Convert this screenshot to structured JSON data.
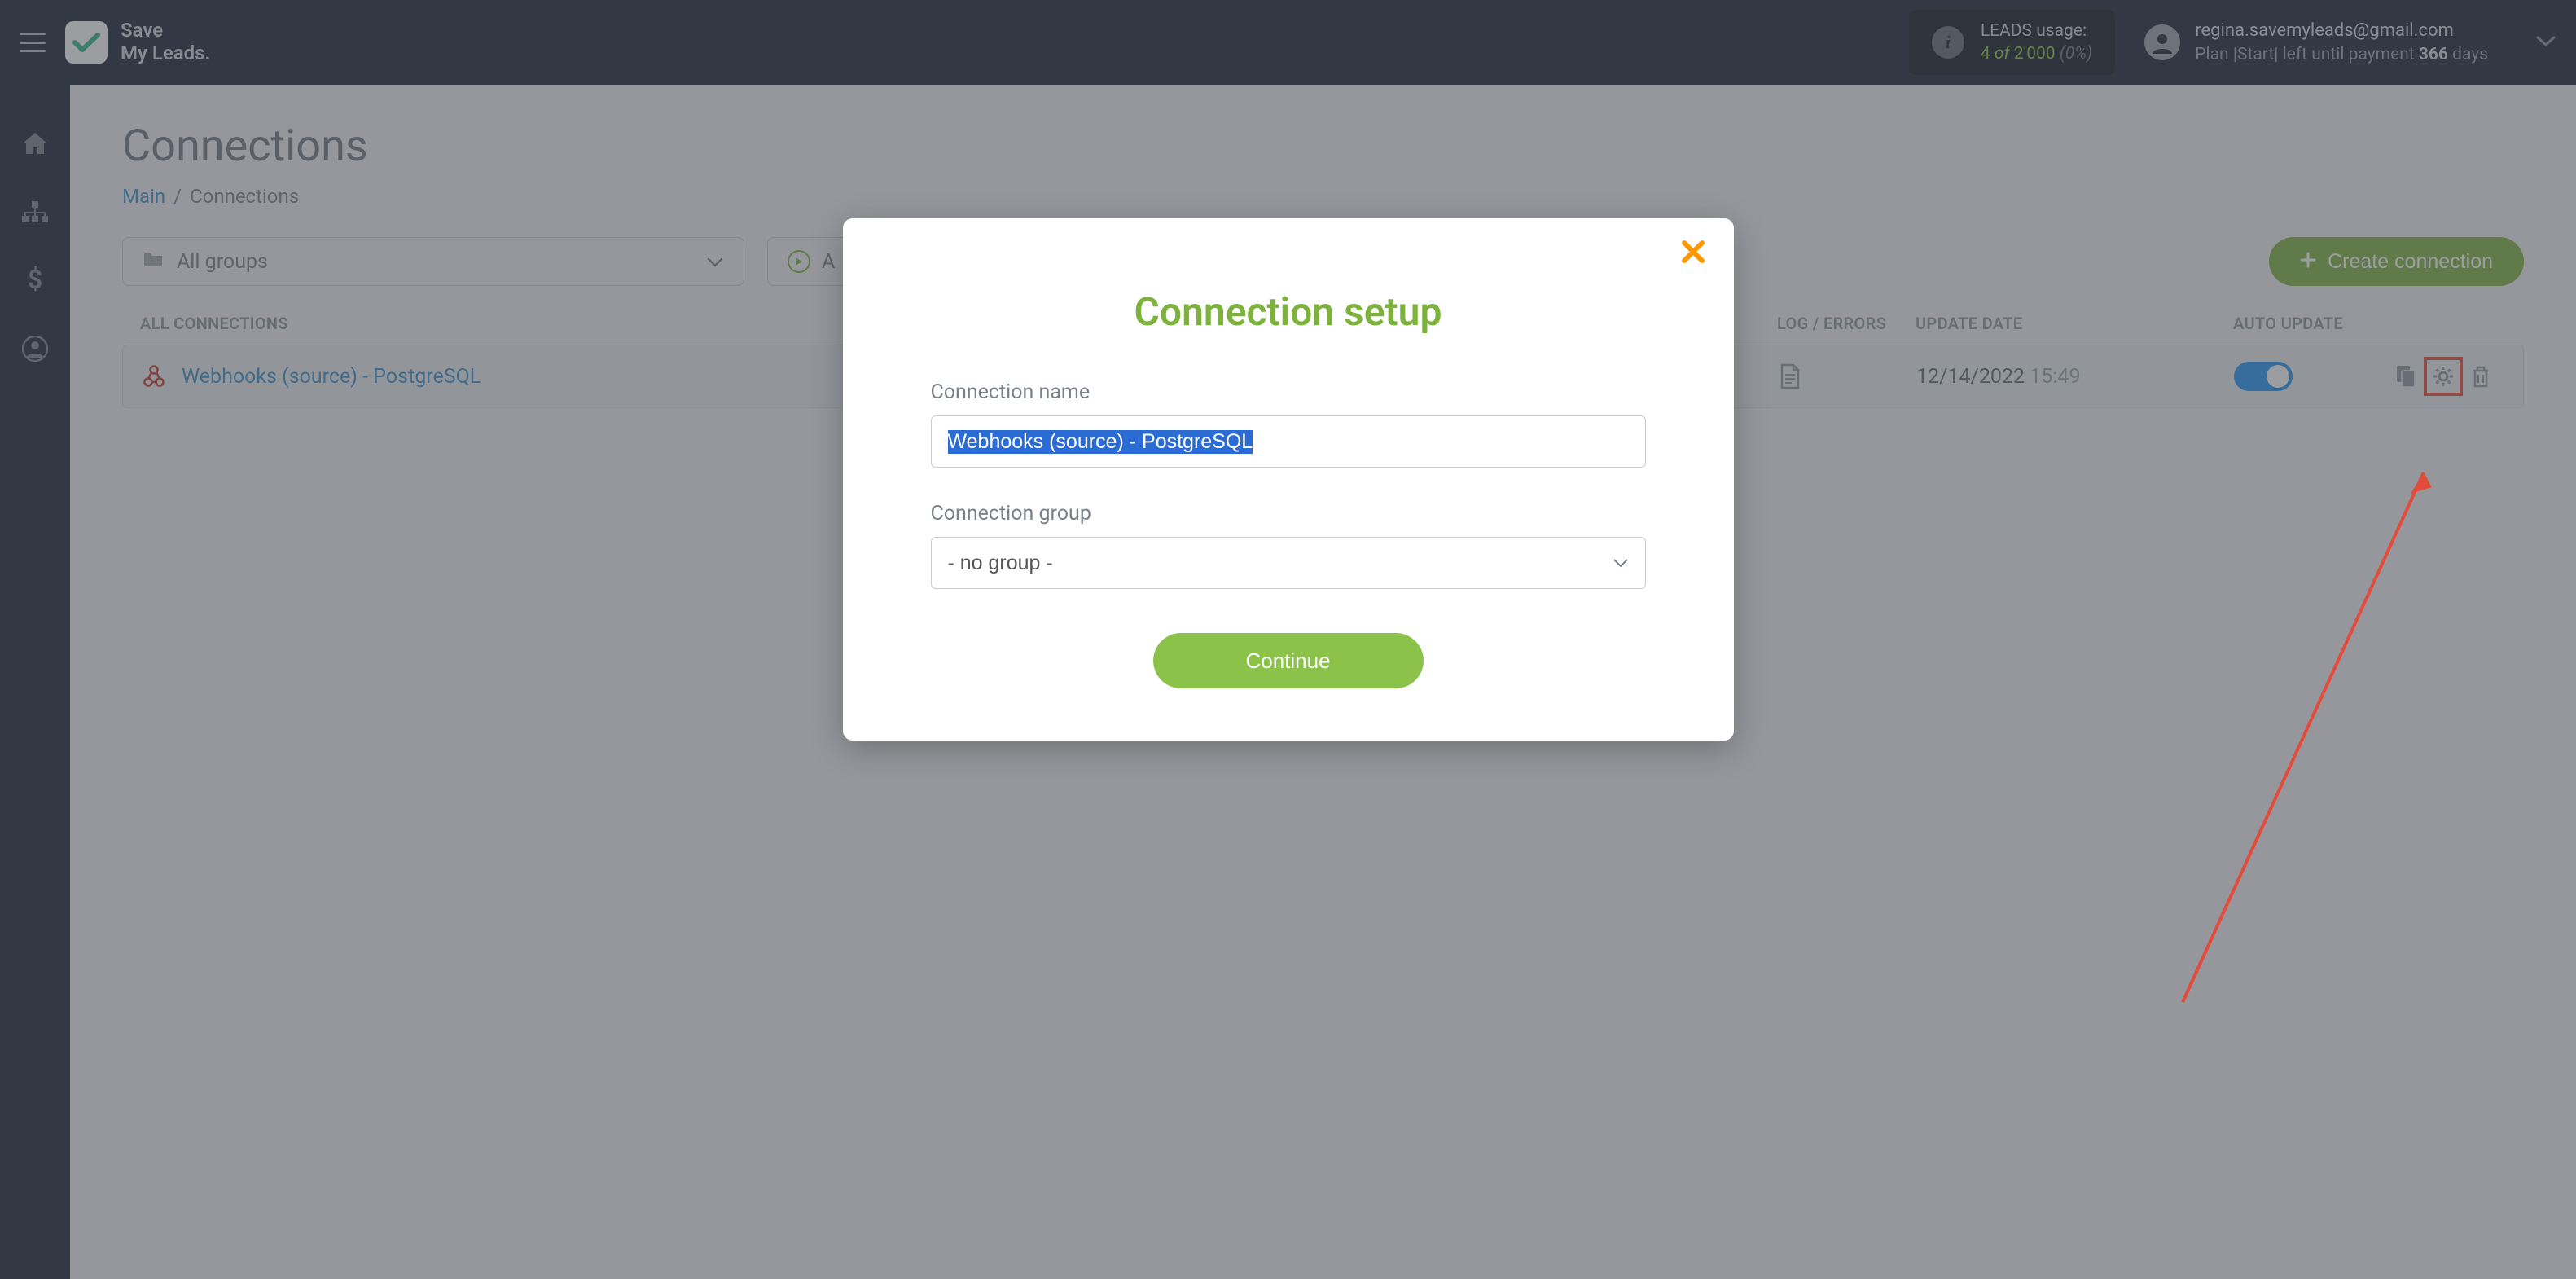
{
  "brand": {
    "line1": "Save",
    "line2": "My Leads."
  },
  "usage": {
    "label": "LEADS usage:",
    "used": "4",
    "of_word": "of",
    "total": "2'000",
    "pct": "(0%)"
  },
  "account": {
    "email": "regina.savemyleads@gmail.com",
    "plan_prefix": "Plan |Start| left until payment ",
    "days": "366",
    "days_word": " days"
  },
  "page": {
    "title": "Connections"
  },
  "breadcrumb": {
    "main": "Main",
    "current": "Connections"
  },
  "toolbar": {
    "groups_label": "All groups",
    "all_label": "A",
    "create_label": "Create connection"
  },
  "table": {
    "headers": {
      "name": "ALL CONNECTIONS",
      "log": "LOG / ERRORS",
      "date": "UPDATE DATE",
      "auto": "AUTO UPDATE"
    },
    "rows": [
      {
        "name": "Webhooks (source) - PostgreSQL",
        "date": "12/14/2022",
        "time": "15:49",
        "auto": true
      }
    ]
  },
  "modal": {
    "title": "Connection setup",
    "name_label": "Connection name",
    "name_value": "Webhooks (source) - PostgreSQL",
    "group_label": "Connection group",
    "group_value": "- no group -",
    "continue": "Continue"
  }
}
